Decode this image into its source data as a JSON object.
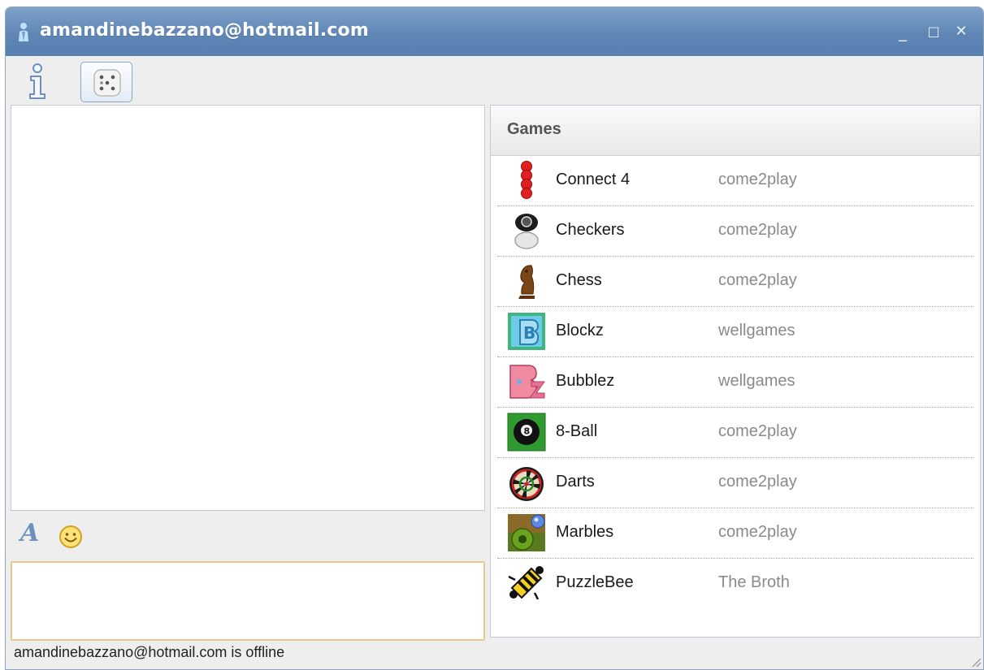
{
  "window": {
    "title": "amandinebazzano@hotmail.com",
    "controls": {
      "minimize": "_",
      "maximize": "□",
      "close": "✕"
    }
  },
  "toolbar": {
    "info_icon": "info-icon",
    "games_icon": "dice-icon"
  },
  "status_text": "amandinebazzano@hotmail.com is offline",
  "format_bar": {
    "font_glyph": "A",
    "emoticon_icon": "smiley-icon"
  },
  "games": {
    "header": "Games",
    "items": [
      {
        "name": "Connect 4",
        "publisher": "come2play",
        "icon": "connect4-icon"
      },
      {
        "name": "Checkers",
        "publisher": "come2play",
        "icon": "checkers-icon"
      },
      {
        "name": "Chess",
        "publisher": "come2play",
        "icon": "chess-icon"
      },
      {
        "name": "Blockz",
        "publisher": "wellgames",
        "icon": "blockz-icon"
      },
      {
        "name": "Bubblez",
        "publisher": "wellgames",
        "icon": "bubblez-icon"
      },
      {
        "name": "8-Ball",
        "publisher": "come2play",
        "icon": "eight-ball-icon"
      },
      {
        "name": "Darts",
        "publisher": "come2play",
        "icon": "darts-icon"
      },
      {
        "name": "Marbles",
        "publisher": "come2play",
        "icon": "marbles-icon"
      },
      {
        "name": "PuzzleBee",
        "publisher": "The Broth",
        "icon": "puzzlebee-icon"
      }
    ]
  },
  "colors": {
    "titlebar": "#5f86b5",
    "input_border": "#e6c78e",
    "accent": "#6d8fbd"
  }
}
